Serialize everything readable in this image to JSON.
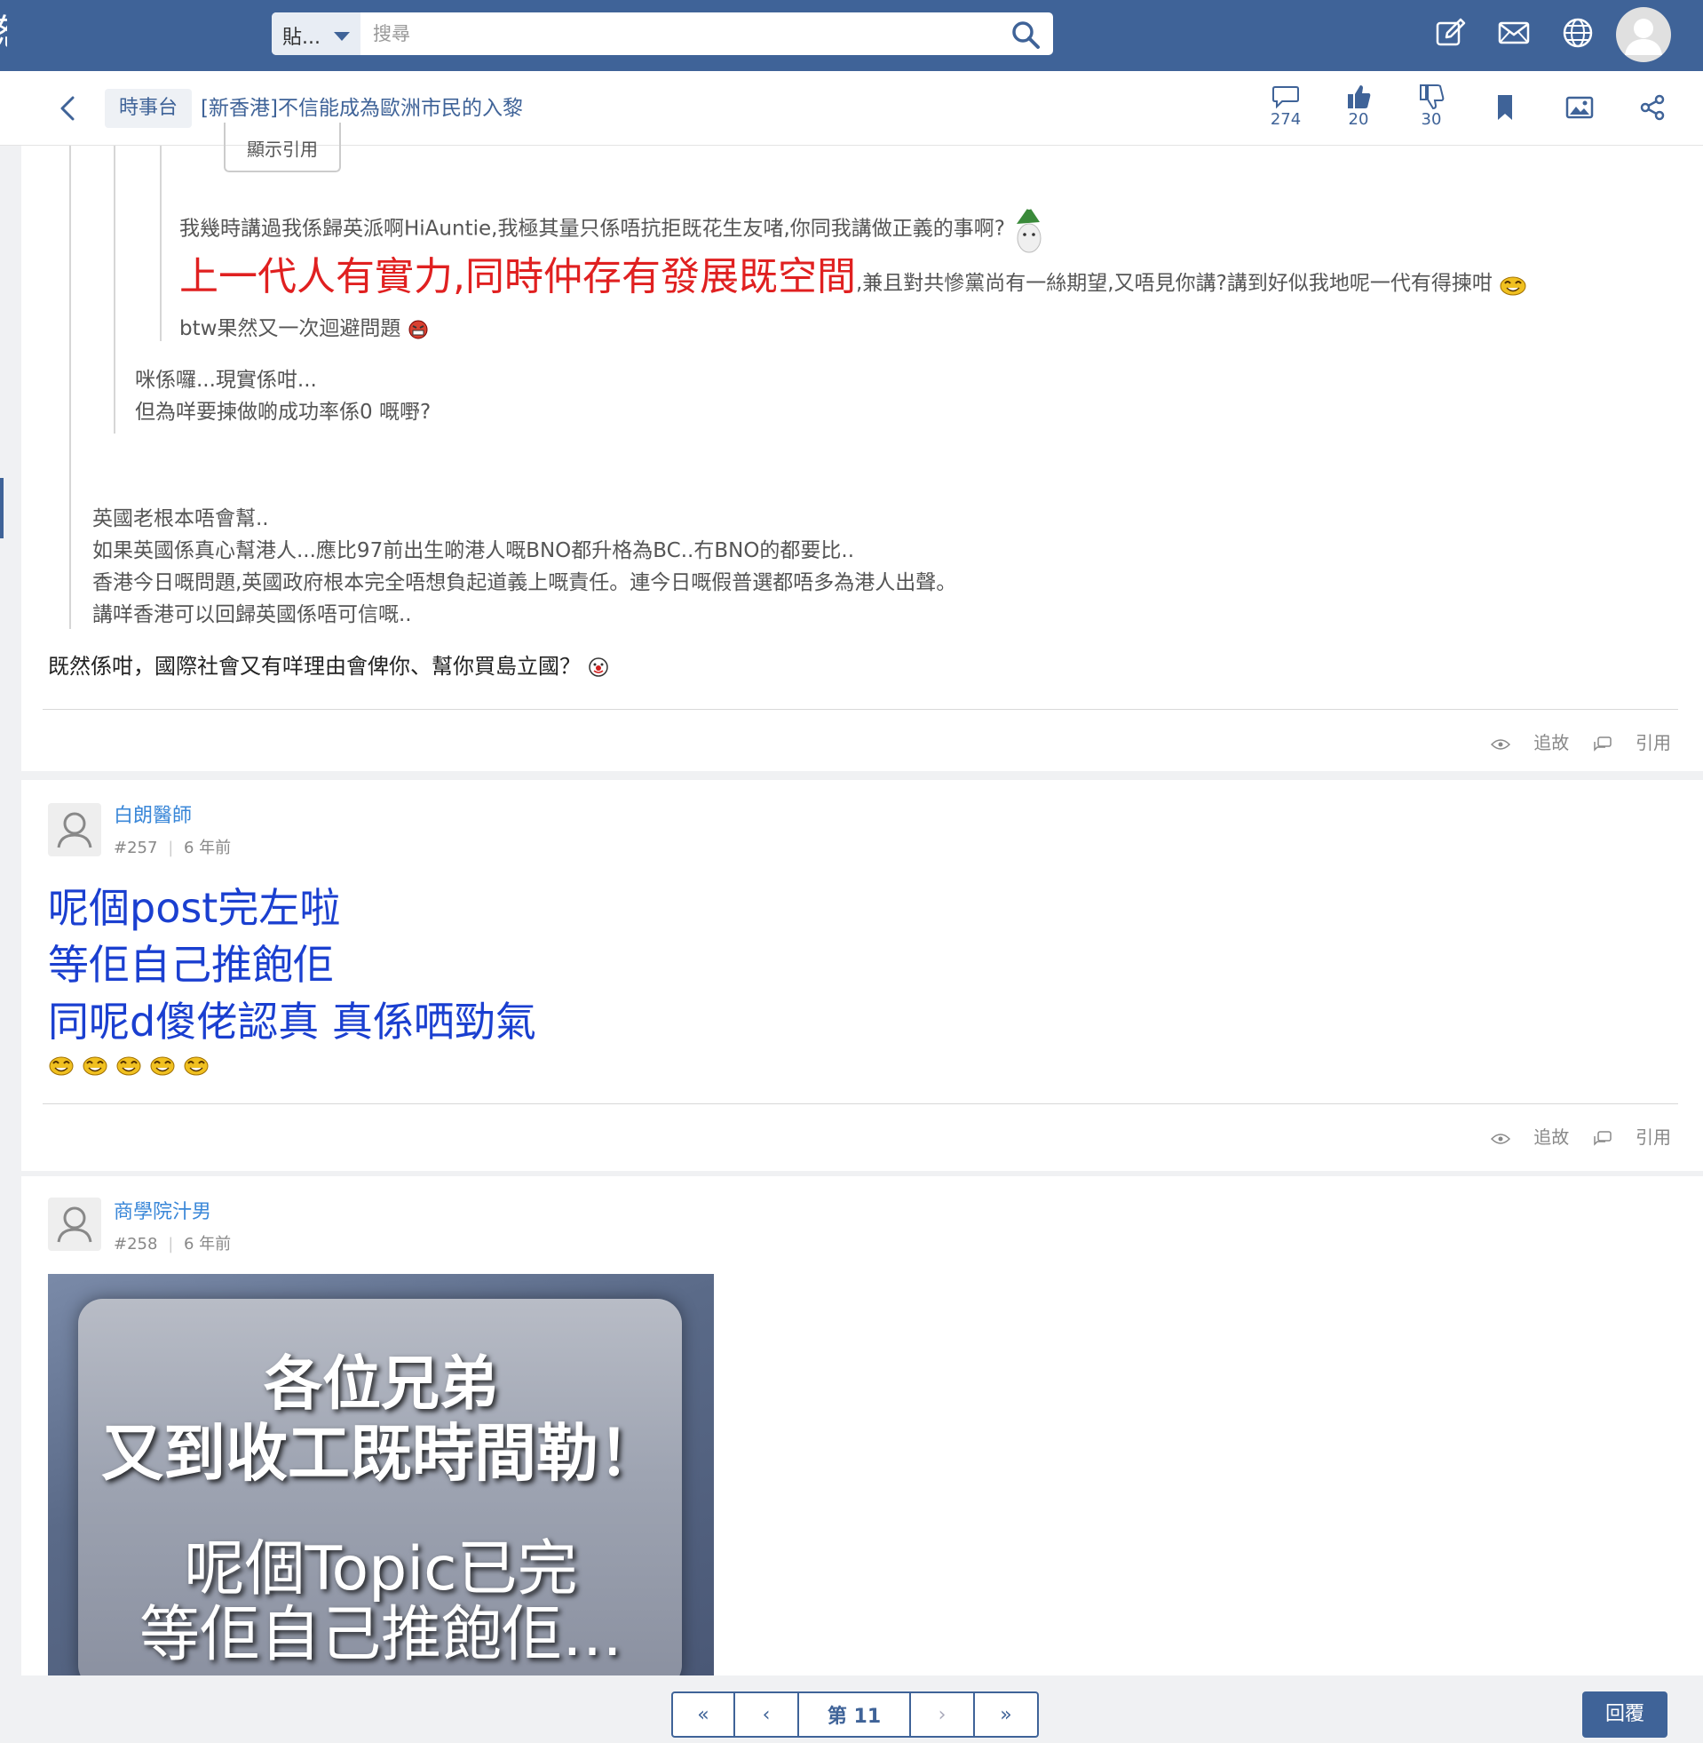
{
  "topbar": {
    "search_scope": "貼...",
    "search_placeholder": "搜尋"
  },
  "thread": {
    "back_label": "<",
    "category": "時事台",
    "title": "[新香港]不信能成為歐洲市民的入黎",
    "stats": {
      "comments": "274",
      "likes": "20",
      "dislikes": "30"
    }
  },
  "post256": {
    "show_quote": "顯示引用",
    "q3_line1": "我幾時講過我係歸英派啊HiAuntie,我極其量只係唔抗拒既花生友啫,你同我講做正義的事啊?",
    "q3_line2_red": "上一代人有實力,同時仲存有發展既空間",
    "q3_line2_rest": ",兼且對共慘黨尚有一絲期望,又唔見你講?講到好似我地呢一代有得揀咁",
    "q3_line3": "btw果然又一次迴避問題",
    "q2_line1": "咪係囉...現實係咁...",
    "q2_line2": "但為咩要揀做啲成功率係0 嘅嘢?",
    "q1_line1": "英國老根本唔會幫..",
    "q1_line2": "如果英國係真心幫港人...應比97前出生啲港人嘅BNO都升格為BC..冇BNO的都要比..",
    "q1_line3": "香港今日嘅問題,英國政府根本完全唔想負起道義上嘅責任。連今日嘅假普選都唔多為港人出聲。",
    "q1_line4": "講咩香港可以回歸英國係唔可信嘅..",
    "reply_text": "既然係咁，國際社會又有咩理由會俾你、幫你買島立國？",
    "action_follow": "追故",
    "action_quote": "引用"
  },
  "post257": {
    "author": "白朗醫師",
    "number": "#257",
    "time": "6 年前",
    "line1": "呢個post完左啦",
    "line2": "等佢自己推飽佢",
    "line3": "同呢d傻佬認真 真係哂勁氣",
    "action_follow": "追故",
    "action_quote": "引用"
  },
  "post258": {
    "author": "商學院汁男",
    "number": "#258",
    "time": "6 年前",
    "image_line1": "各位兄弟",
    "image_line2": "又到收工既時間勒！",
    "image_line3": "呢個Topic已完",
    "image_line4": "等佢自己推飽佢…"
  },
  "pager": {
    "first": "«",
    "prev": "‹",
    "current": "第 11",
    "next": "›",
    "last": "»"
  },
  "reply_button": "回覆",
  "colors": {
    "brand": "#3f6398",
    "link_blue": "#3a87d8",
    "red_text": "#e02020",
    "big_blue": "#1a3fd0"
  }
}
